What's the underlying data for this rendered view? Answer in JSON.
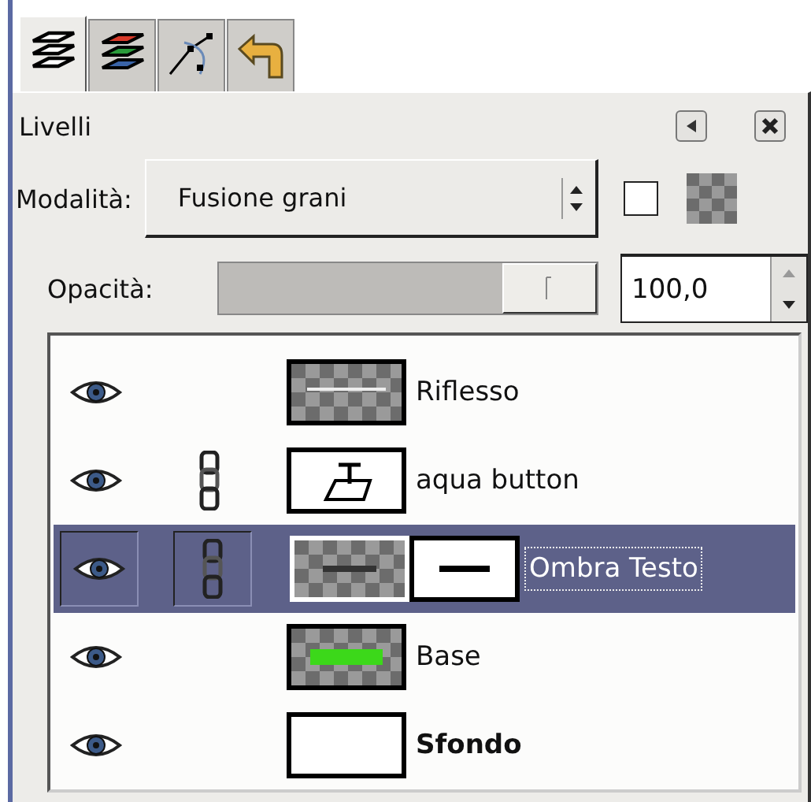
{
  "tabs": [
    {
      "kind": "layers",
      "selected": true
    },
    {
      "kind": "channels",
      "selected": false
    },
    {
      "kind": "paths",
      "selected": false
    },
    {
      "kind": "undo",
      "selected": false
    }
  ],
  "panel": {
    "title": "Livelli"
  },
  "mode": {
    "label": "Modalità:",
    "value": "Fusione grani",
    "lock_alpha": false
  },
  "opacity": {
    "label": "Opacità:",
    "level": 1,
    "value": "100,0"
  },
  "layers": [
    {
      "name": "Riflesso",
      "visible": true,
      "linked": false,
      "selected": false,
      "bold": false,
      "kind": "line",
      "mask": false
    },
    {
      "name": "aqua button",
      "visible": true,
      "linked": true,
      "selected": false,
      "bold": false,
      "kind": "text",
      "mask": false
    },
    {
      "name": "Ombra Testo",
      "visible": true,
      "linked": true,
      "selected": true,
      "bold": false,
      "kind": "shadow",
      "mask": true
    },
    {
      "name": "Base",
      "visible": true,
      "linked": false,
      "selected": false,
      "bold": false,
      "kind": "green",
      "mask": false
    },
    {
      "name": "Sfondo",
      "visible": true,
      "linked": false,
      "selected": false,
      "bold": true,
      "kind": "white",
      "mask": false
    }
  ]
}
